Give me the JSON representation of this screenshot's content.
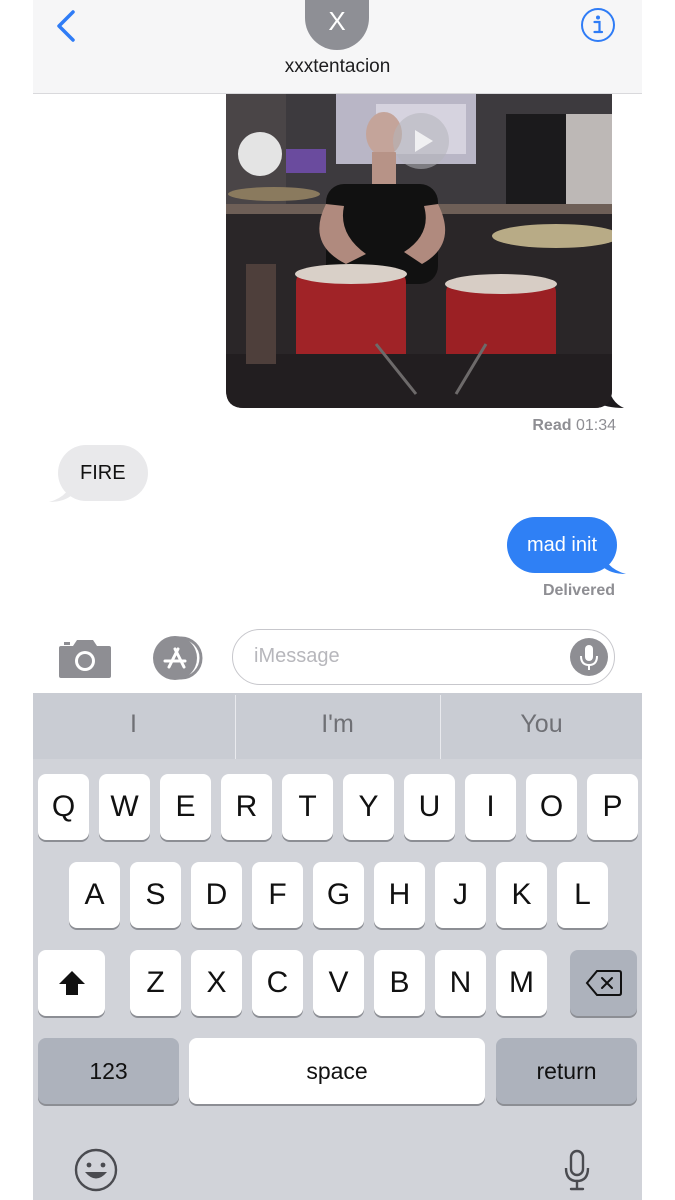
{
  "header": {
    "avatar_initial": "X",
    "contact_name": "xxxtentacion"
  },
  "messages": {
    "video_receipt_status": "Read",
    "video_receipt_time": "01:34",
    "incoming_text": "FIRE",
    "outgoing_text": "mad init",
    "outgoing_status": "Delivered"
  },
  "input": {
    "placeholder": "iMessage"
  },
  "keyboard": {
    "predictions": [
      "I",
      "I'm",
      "You"
    ],
    "row1": [
      "Q",
      "W",
      "E",
      "R",
      "T",
      "Y",
      "U",
      "I",
      "O",
      "P"
    ],
    "row2": [
      "A",
      "S",
      "D",
      "F",
      "G",
      "H",
      "J",
      "K",
      "L"
    ],
    "row3": [
      "Z",
      "X",
      "C",
      "V",
      "B",
      "N",
      "M"
    ],
    "numbers_label": "123",
    "space_label": "space",
    "return_label": "return"
  },
  "colors": {
    "outgoing_bubble": "#2f80f5",
    "incoming_bubble": "#e9e9eb",
    "accent": "#2f7cf6",
    "keyboard_bg": "#d1d3d9"
  }
}
